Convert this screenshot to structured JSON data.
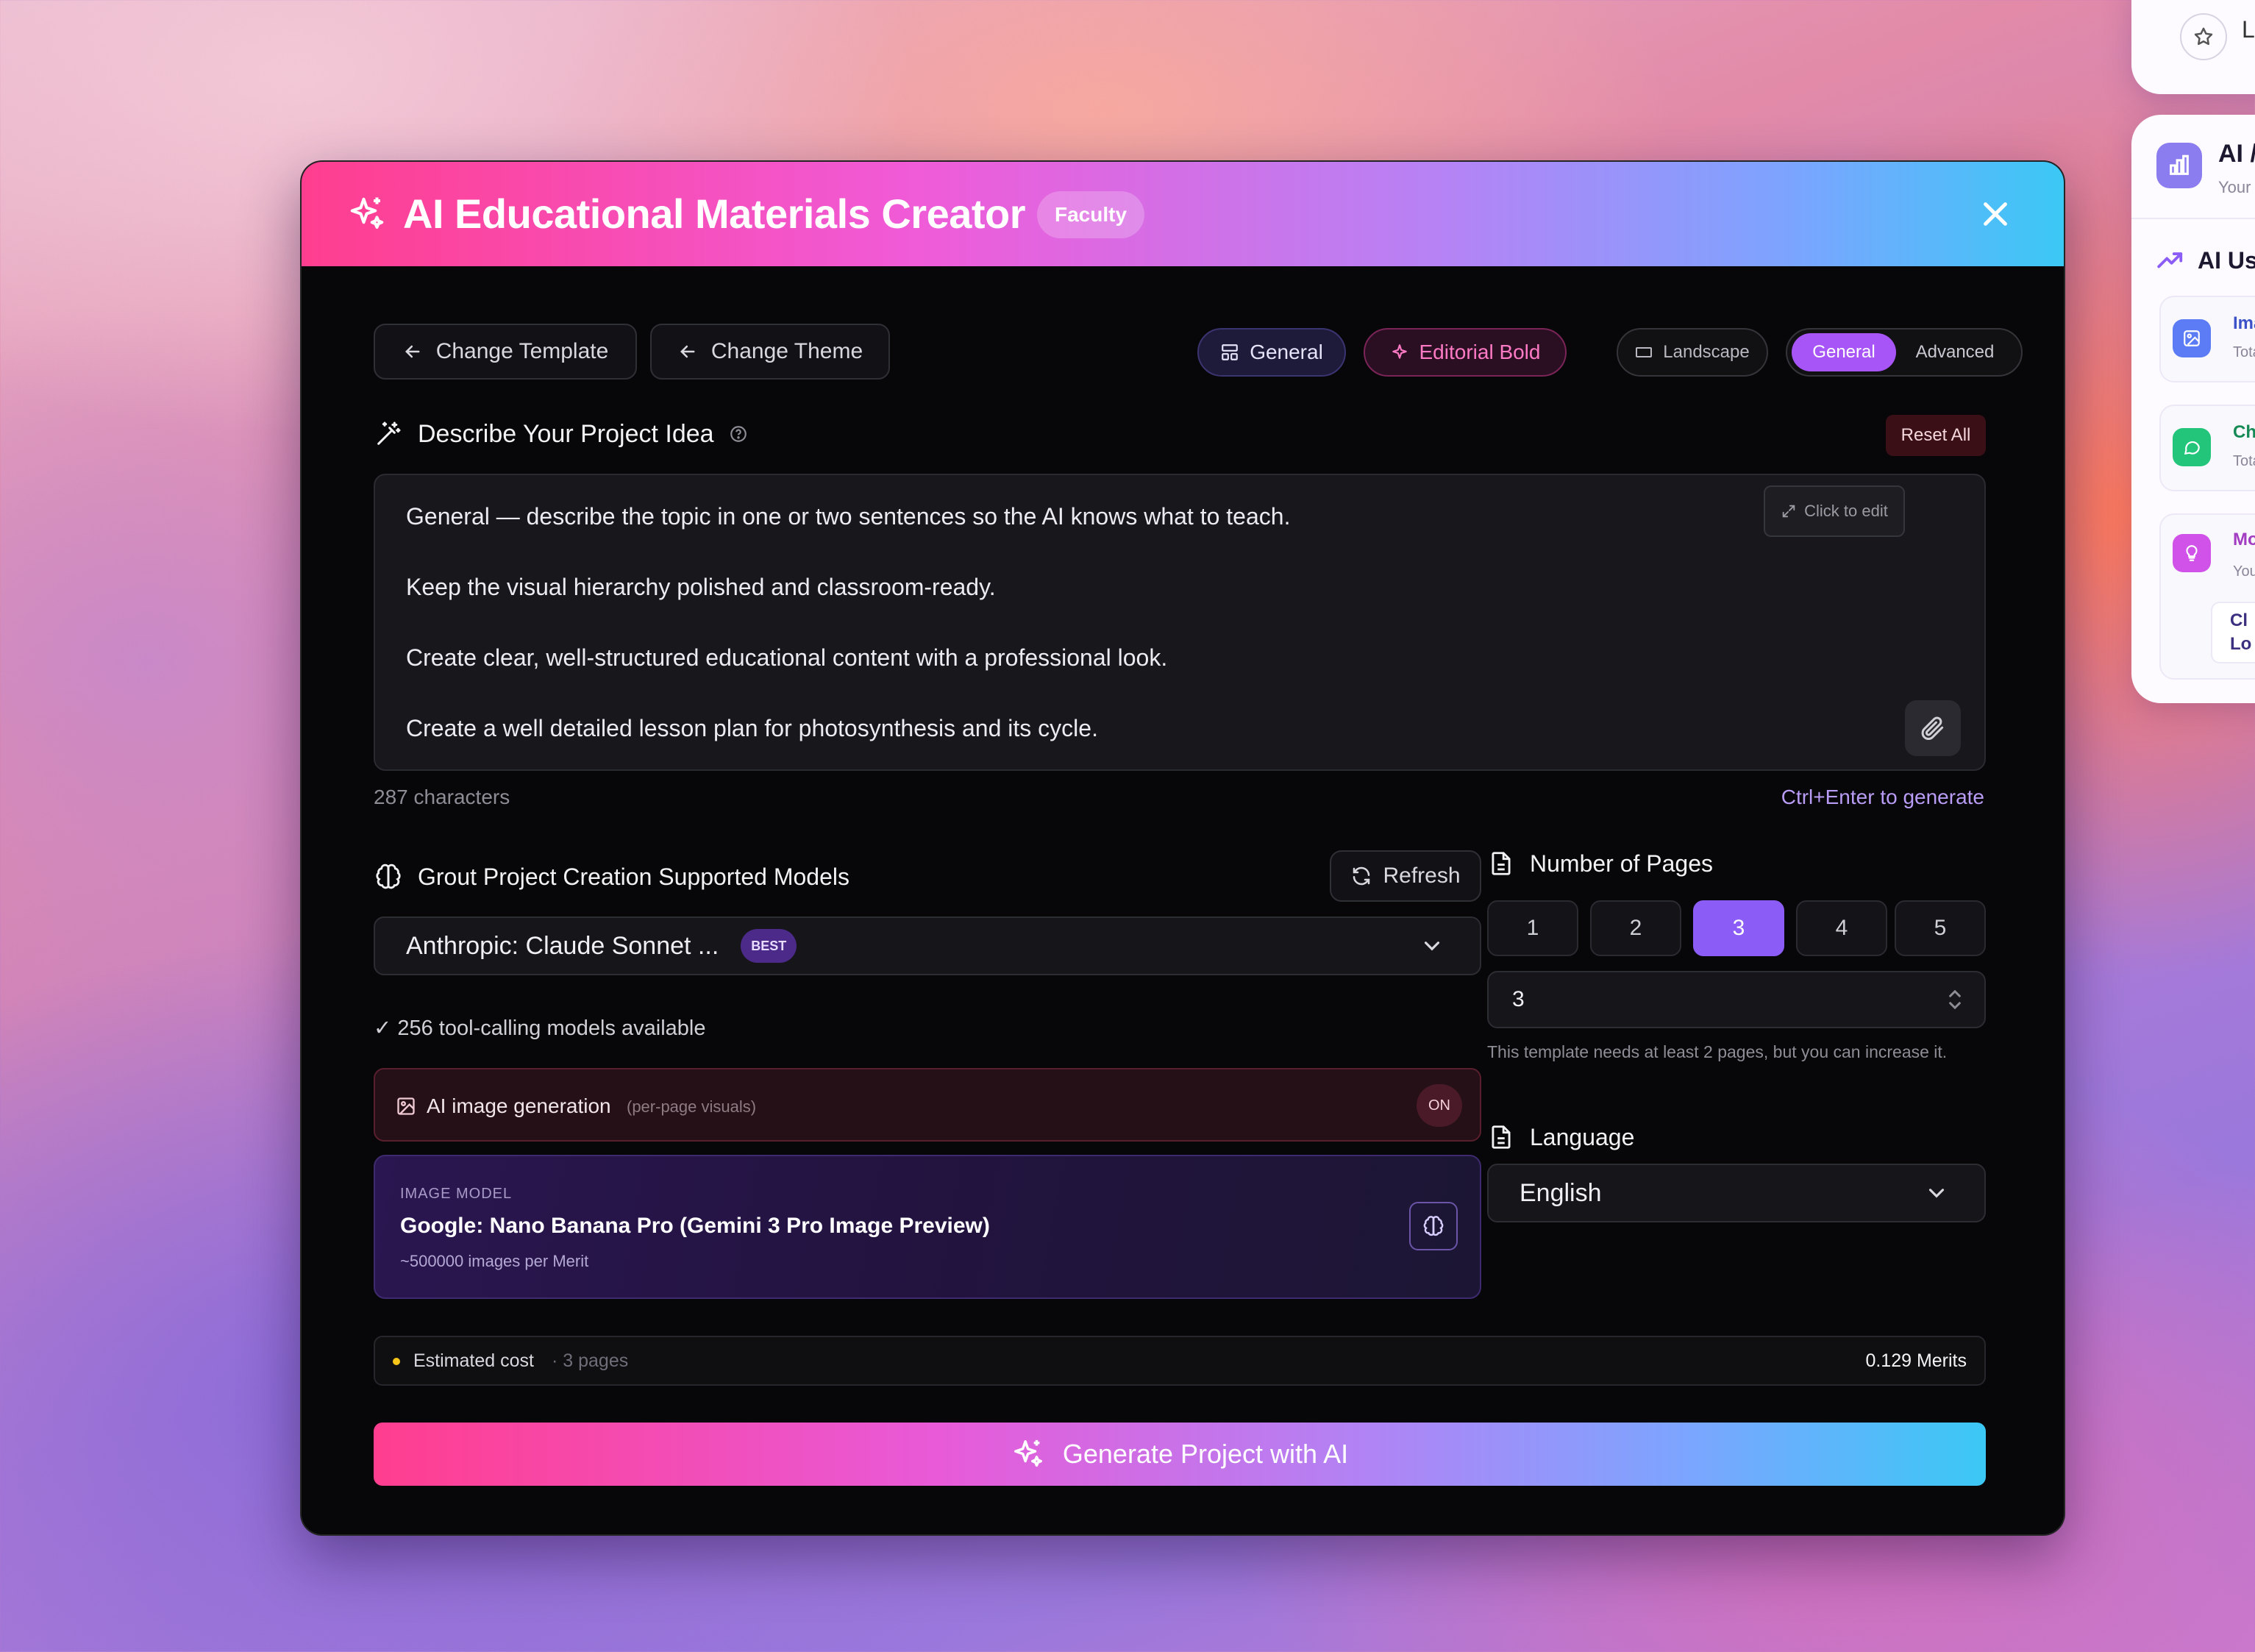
{
  "side": {
    "top_label": "L",
    "main_title": "AI /",
    "main_sub": "Your",
    "usage_title": "AI Us",
    "items": [
      {
        "title": "Imag",
        "sub": "Total"
      },
      {
        "title": "Cha",
        "sub": "Total"
      },
      {
        "title": "Mos",
        "sub": "Your",
        "extra1": "Cl",
        "extra2": "Lo"
      }
    ]
  },
  "modal": {
    "title": "AI Educational Materials Creator",
    "badge": "Faculty"
  },
  "toolbar": {
    "change_template": "Change Template",
    "change_theme": "Change Theme",
    "template_pill": "General",
    "theme_pill": "Editorial Bold",
    "orientation_pill": "Landscape",
    "mode_general": "General",
    "mode_advanced": "Advanced"
  },
  "prompt": {
    "title": "Describe Your Project Idea",
    "reset_label": "Reset All",
    "click_to_edit": "Click to edit",
    "lines": [
      "General — describe the topic in one or two sentences so the AI knows what to teach.",
      "Keep the visual hierarchy polished and classroom-ready.",
      "Create clear, well-structured educational content with a professional look.",
      "Create a well detailed lesson plan for photosynthesis and its cycle."
    ],
    "char_count": "287 characters",
    "shortcut_hint": "Ctrl+Enter to generate"
  },
  "models": {
    "title": "Grout Project Creation Supported Models",
    "refresh_label": "Refresh",
    "selected_model": "Anthropic: Claude Sonnet ...",
    "best_badge": "BEST",
    "available_text": "✓ 256 tool-calling models available",
    "ai_image_label": "AI image generation",
    "ai_image_hint": "(per-page visuals)",
    "ai_image_state": "ON",
    "image_model_caption": "IMAGE MODEL",
    "image_model_name": "Google: Nano Banana Pro (Gemini 3 Pro Image Preview)",
    "image_model_rate": "~500000 images per Merit"
  },
  "pages": {
    "title": "Number of Pages",
    "options": [
      "1",
      "2",
      "3",
      "4",
      "5"
    ],
    "selected": "3",
    "input_value": "3",
    "hint": "This template needs at least 2 pages, but you can increase it."
  },
  "language": {
    "title": "Language",
    "selected": "English"
  },
  "cost": {
    "label": "Estimated cost",
    "pages_note": "· 3 pages",
    "value": "0.129 Merits"
  },
  "generate": {
    "label": "Generate Project with AI"
  },
  "colors": {
    "accent": "#8b5cf6",
    "danger_bg": "#3a0f16",
    "header_start": "#ff3e8f",
    "header_end": "#3bc8f5"
  }
}
